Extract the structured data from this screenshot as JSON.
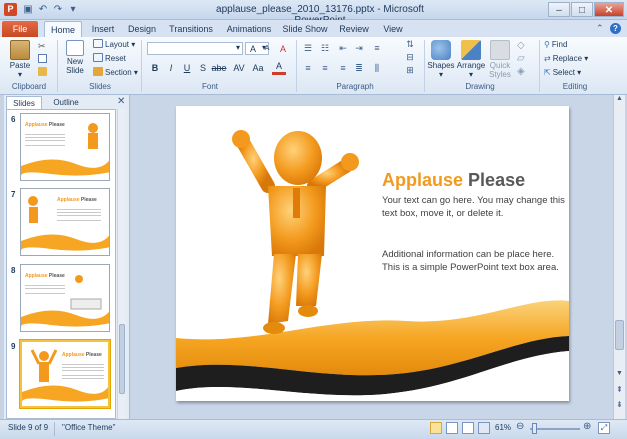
{
  "window": {
    "title": "applause_please_2010_13176.pptx - Microsoft PowerPoint",
    "app_icon": "P",
    "minimize": "–",
    "maximize": "□",
    "close": "✕"
  },
  "tabs": [
    "File",
    "Home",
    "Insert",
    "Design",
    "Transitions",
    "Animations",
    "Slide Show",
    "Review",
    "View"
  ],
  "ribbon": {
    "clipboard": {
      "paste": "Paste",
      "group": "Clipboard"
    },
    "slides": {
      "new_slide": "New Slide",
      "layout": "Layout",
      "reset": "Reset",
      "section": "Section",
      "group": "Slides"
    },
    "font": {
      "group": "Font",
      "bold": "B",
      "italic": "I",
      "underline": "U",
      "strike": "S",
      "shadow": "abe",
      "spacing": "AV",
      "case": "Aa",
      "grow": "A",
      "shrink": "A",
      "clear": "A"
    },
    "paragraph": {
      "group": "Paragraph"
    },
    "drawing": {
      "shapes": "Shapes",
      "arrange": "Arrange",
      "quick_styles": "Quick Styles",
      "group": "Drawing"
    },
    "editing": {
      "find": "Find",
      "replace": "Replace",
      "select": "Select",
      "group": "Editing"
    }
  },
  "left_pane": {
    "tab_slides": "Slides",
    "tab_outline": "Outline",
    "close": "✕",
    "thumbnails": [
      {
        "num": "6",
        "title_a": "Applause",
        "title_b": "Please"
      },
      {
        "num": "7",
        "title_a": "Applause",
        "title_b": "Please"
      },
      {
        "num": "8",
        "title_a": "Applause",
        "title_b": "Please"
      },
      {
        "num": "9",
        "title_a": "Applause",
        "title_b": "Please"
      }
    ]
  },
  "slide": {
    "title_a": "Applause",
    "title_b": "Please",
    "para1": "Your text can go here.  You may change this text box, move it, or delete it.",
    "para2": "Additional information can be place here. This is a simple PowerPoint text box area."
  },
  "status": {
    "slide": "Slide 9 of 9",
    "theme": "\"Office Theme\"",
    "zoom": "61%"
  }
}
